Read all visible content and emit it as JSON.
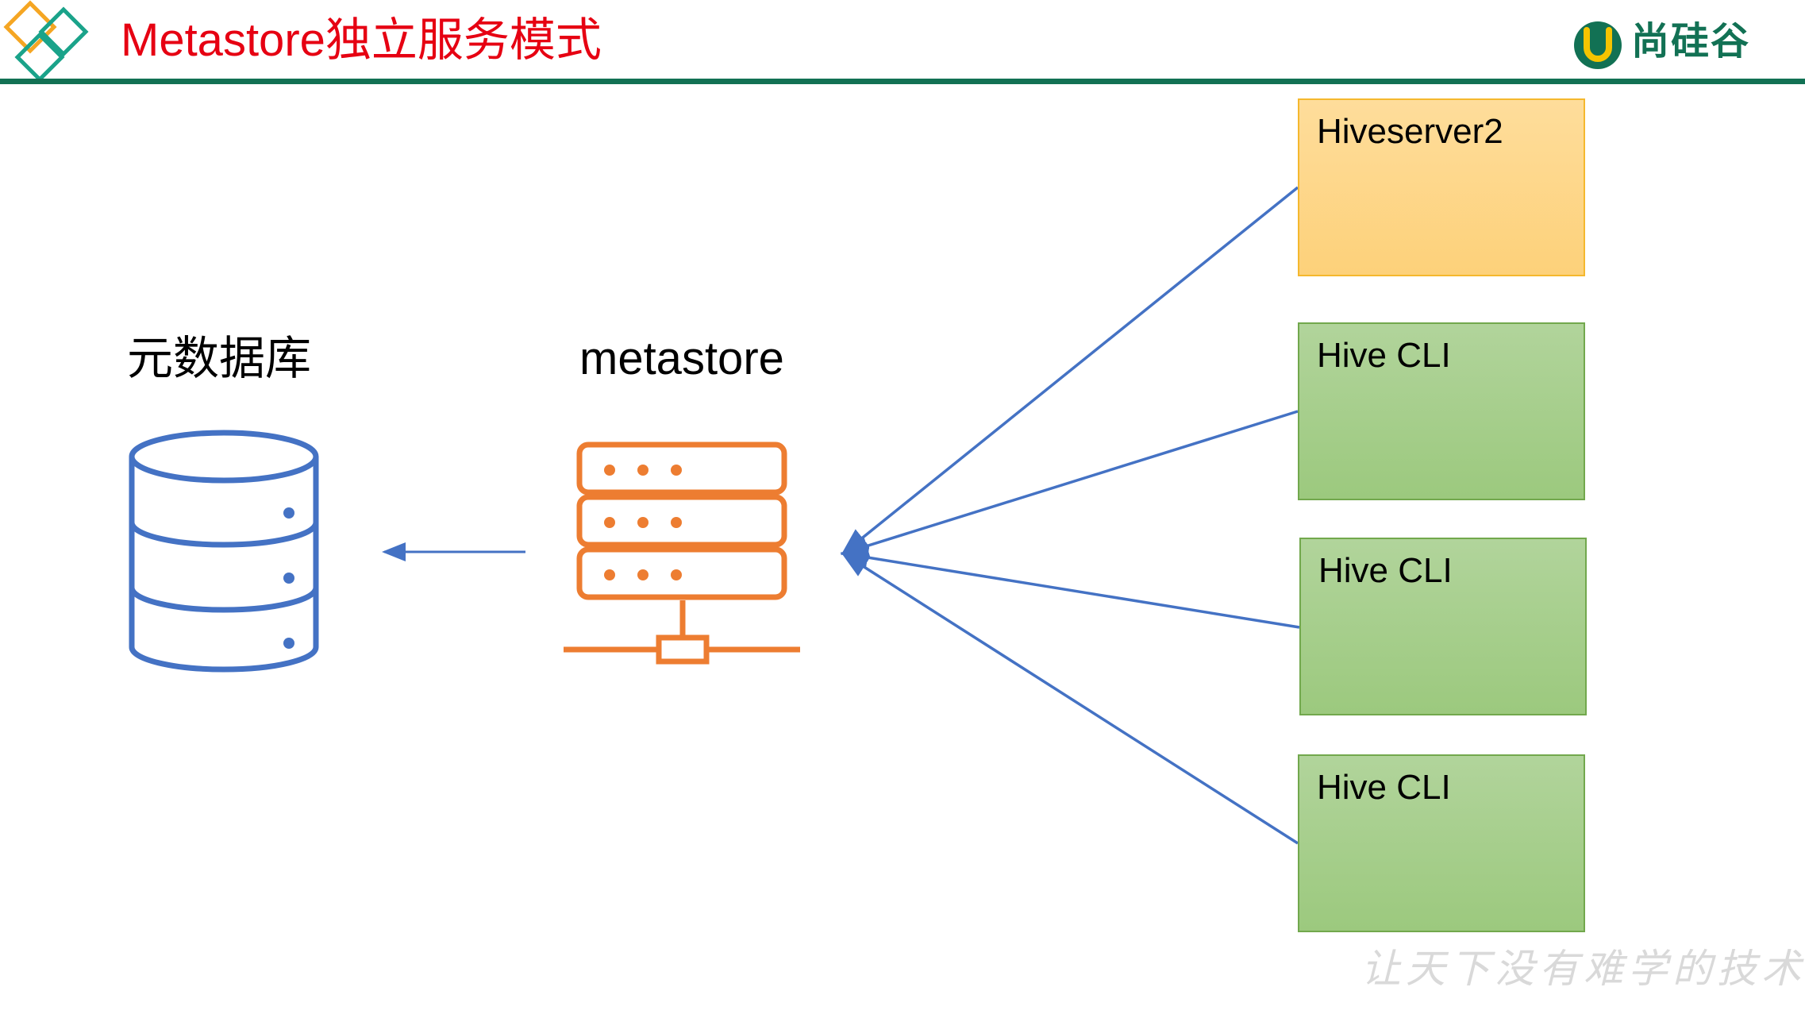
{
  "header": {
    "title": "Metastore独立服务模式",
    "logo_text": "尚硅谷",
    "title_color": "#e60012",
    "rule_color": "#127154"
  },
  "diagram": {
    "database_label": "元数据库",
    "metastore_label": "metastore",
    "database_icon": "database-icon",
    "server_icon": "server-network-icon",
    "clients": [
      {
        "label": "Hiveserver2",
        "kind": "hiveserver2",
        "color": "#fdd17a"
      },
      {
        "label": "Hive CLI",
        "kind": "hive-cli",
        "color": "#9cc97e"
      },
      {
        "label": "Hive CLI",
        "kind": "hive-cli",
        "color": "#9cc97e"
      },
      {
        "label": "Hive CLI",
        "kind": "hive-cli",
        "color": "#9cc97e"
      }
    ],
    "colors": {
      "database": "#4472c4",
      "server": "#ed7d31",
      "connector": "#4472c4"
    }
  },
  "footer": {
    "slogan": "让天下没有难学的技术"
  }
}
